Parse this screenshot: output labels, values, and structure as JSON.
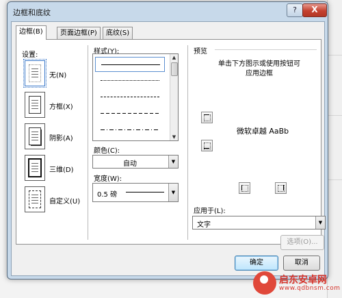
{
  "dialog": {
    "title": "边框和底纹",
    "help_glyph": "?",
    "close_glyph": "X"
  },
  "tabs": [
    {
      "label": "边框(B)",
      "active": true
    },
    {
      "label": "页面边框(P)",
      "active": false
    },
    {
      "label": "底纹(S)",
      "active": false
    }
  ],
  "settings": {
    "heading": "设置:",
    "items": [
      {
        "label": "无(N)",
        "icon": "no-border-icon",
        "selected": true
      },
      {
        "label": "方框(X)",
        "icon": "box-border-icon",
        "selected": false
      },
      {
        "label": "阴影(A)",
        "icon": "shadow-border-icon",
        "selected": false
      },
      {
        "label": "三维(D)",
        "icon": "3d-border-icon",
        "selected": false
      },
      {
        "label": "自定义(U)",
        "icon": "custom-border-icon",
        "selected": false
      }
    ]
  },
  "style": {
    "heading": "样式(Y):",
    "lines": [
      "solid",
      "dotted",
      "dashed-small",
      "dashed",
      "dash-dot"
    ]
  },
  "color": {
    "heading": "颜色(C):",
    "value": "自动"
  },
  "width": {
    "heading": "宽度(W):",
    "value": "0.5 磅"
  },
  "preview": {
    "heading": "预览",
    "hint_line1": "单击下方图示或使用按钮可",
    "hint_line2": "应用边框",
    "sample_text": "微软卓越  AaBb"
  },
  "apply_to": {
    "heading": "应用于(L):",
    "value": "文字"
  },
  "buttons": {
    "options": "选项(O)...",
    "ok": "确定",
    "cancel": "取消"
  },
  "watermark": {
    "name": "启东安卓网",
    "url": "www.qdbnsm.com"
  }
}
